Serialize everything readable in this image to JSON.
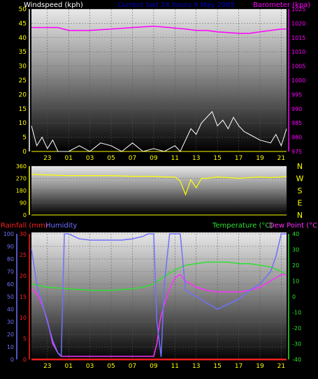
{
  "colors": {
    "windspeed": "#ffffff",
    "barometer": "#ff00ff",
    "direction": "#ffff00",
    "rainfall": "#ff2020",
    "humidity": "#7070ff",
    "temperature": "#30e030",
    "dewpoint": "#ff30ff",
    "axis": "#ffff00",
    "hours": "#ffff00",
    "subtitle": "#0000cc"
  },
  "chart_data": [
    {
      "type": "line",
      "title": "",
      "subtitle": "Current last 24 hours 9 May 2005",
      "left_label": "Windspeed (kph)",
      "right_label": "Barometer (kpa)",
      "x_ticks": [
        "23",
        "01",
        "03",
        "05",
        "07",
        "09",
        "11",
        "13",
        "15",
        "17",
        "19",
        "21"
      ],
      "y_left_ticks": [
        "0",
        "5",
        "10",
        "15",
        "20",
        "25",
        "30",
        "35",
        "40",
        "45",
        "50"
      ],
      "y_right_ticks": [
        "975",
        "980",
        "985",
        "990",
        "995",
        "1000",
        "1005",
        "1010",
        "1015",
        "1020",
        "1025"
      ],
      "ylim_left": [
        0,
        50
      ],
      "ylim_right": [
        975,
        1025
      ],
      "series": [
        {
          "name": "Barometer",
          "axis": "right",
          "x": [
            21.5,
            23,
            24,
            25,
            27,
            29,
            31,
            33,
            34.5,
            36,
            37,
            38,
            39,
            41,
            42,
            43,
            44,
            45,
            45.5
          ],
          "y": [
            1018.5,
            1018.5,
            1018.5,
            1017.5,
            1017.5,
            1018.0,
            1018.5,
            1019.0,
            1018.5,
            1018.0,
            1017.5,
            1017.5,
            1017.0,
            1016.5,
            1016.5,
            1017.0,
            1017.5,
            1018.0,
            1018.0
          ]
        },
        {
          "name": "Windspeed",
          "axis": "left",
          "x": [
            21.5,
            22,
            22.5,
            23,
            23.5,
            24,
            25,
            26,
            27,
            28,
            29,
            30,
            31,
            32,
            33,
            34,
            35,
            35.5,
            36,
            36.5,
            37,
            37.5,
            38,
            38.5,
            39,
            39.5,
            40,
            40.5,
            41,
            41.5,
            42,
            43,
            44,
            44.5,
            45,
            45.5
          ],
          "y": [
            9,
            2,
            5,
            1,
            4,
            0,
            0,
            2,
            0,
            3,
            2,
            0,
            3,
            0,
            1,
            0,
            2,
            0,
            4,
            8,
            6,
            10,
            12,
            14,
            9,
            11,
            8,
            12,
            9,
            7,
            6,
            4,
            3,
            6,
            2,
            8
          ]
        }
      ]
    },
    {
      "type": "line",
      "title": "",
      "y_left_ticks": [
        "0",
        "90",
        "180",
        "270",
        "360"
      ],
      "y_right_ticks": [
        "N",
        "W",
        "S",
        "E",
        "N"
      ],
      "ylim": [
        0,
        360
      ],
      "series": [
        {
          "name": "Wind direction",
          "x": [
            21.5,
            23,
            25,
            27,
            29,
            31,
            33,
            34,
            35,
            35.5,
            36,
            36.5,
            37,
            37.5,
            38,
            39,
            40,
            41,
            42,
            43,
            44,
            45,
            45.5
          ],
          "y": [
            300,
            295,
            290,
            290,
            290,
            285,
            285,
            280,
            280,
            250,
            150,
            260,
            200,
            270,
            270,
            280,
            275,
            270,
            275,
            280,
            275,
            280,
            285
          ]
        }
      ]
    },
    {
      "type": "line",
      "title": "",
      "left_label_1": "Rainfall (mm)",
      "left_label_2": "Humidity",
      "right_label_1": "Temperature (°C)",
      "right_label_2": "Dew Point (°C)",
      "x_ticks": [
        "23",
        "01",
        "03",
        "05",
        "07",
        "09",
        "11",
        "13",
        "15",
        "17",
        "19",
        "21"
      ],
      "y_rain_ticks": [
        "0",
        "5",
        "10",
        "15",
        "20",
        "25",
        "30"
      ],
      "y_hum_ticks": [
        "0",
        "10",
        "20",
        "30",
        "40",
        "50",
        "60",
        "70",
        "80",
        "90",
        "100"
      ],
      "y_temp_ticks": [
        "40",
        "30",
        "20",
        "10",
        "0",
        "-10",
        "-20",
        "-30",
        "-40"
      ],
      "ylim_rain": [
        0,
        30
      ],
      "ylim_humidity": [
        0,
        100
      ],
      "ylim_temp": [
        -40,
        40
      ],
      "series": [
        {
          "name": "Humidity",
          "axis": "humidity",
          "x": [
            21.5,
            22,
            22.5,
            23,
            23.5,
            24,
            24.3,
            24.6,
            25,
            26,
            27,
            28,
            29,
            30,
            31,
            32,
            32.5,
            33,
            33.3,
            33.7,
            34,
            34.5,
            35,
            35.5,
            36,
            37,
            38,
            39,
            40,
            41,
            42,
            43,
            44,
            44.5,
            45,
            45.5
          ],
          "y": [
            88,
            60,
            45,
            30,
            15,
            5,
            3,
            100,
            100,
            96,
            95,
            95,
            95,
            95,
            96,
            98,
            100,
            100,
            30,
            2,
            60,
            100,
            100,
            100,
            55,
            50,
            45,
            40,
            44,
            48,
            55,
            60,
            70,
            82,
            100,
            100
          ]
        },
        {
          "name": "Temperature",
          "axis": "temp",
          "x": [
            21.5,
            23,
            25,
            27,
            29,
            31,
            32,
            33,
            34,
            35,
            36,
            37,
            38,
            39,
            40,
            41,
            42,
            43,
            44,
            45,
            45.5
          ],
          "y": [
            8,
            6,
            5,
            4,
            4,
            5,
            6,
            8,
            13,
            17,
            20,
            21,
            22,
            22,
            22,
            21,
            21,
            20,
            19,
            16,
            14
          ]
        },
        {
          "name": "Dew Point",
          "axis": "temp",
          "x": [
            21.5,
            22,
            22.5,
            23,
            23.5,
            24,
            24.3,
            33,
            33.3,
            33.6,
            34,
            34.5,
            35,
            35.5,
            36,
            37,
            38,
            39,
            40,
            41,
            42,
            43,
            44,
            45,
            45.5
          ],
          "y": [
            5,
            2,
            -5,
            -15,
            -30,
            -36,
            -38,
            -38,
            -30,
            -15,
            -5,
            5,
            12,
            14,
            10,
            6,
            4,
            3,
            3,
            3,
            4,
            6,
            10,
            14,
            14
          ]
        },
        {
          "name": "Rainfall",
          "axis": "rain",
          "x": [
            21.5,
            45.5
          ],
          "y": [
            0,
            0
          ]
        }
      ]
    }
  ]
}
